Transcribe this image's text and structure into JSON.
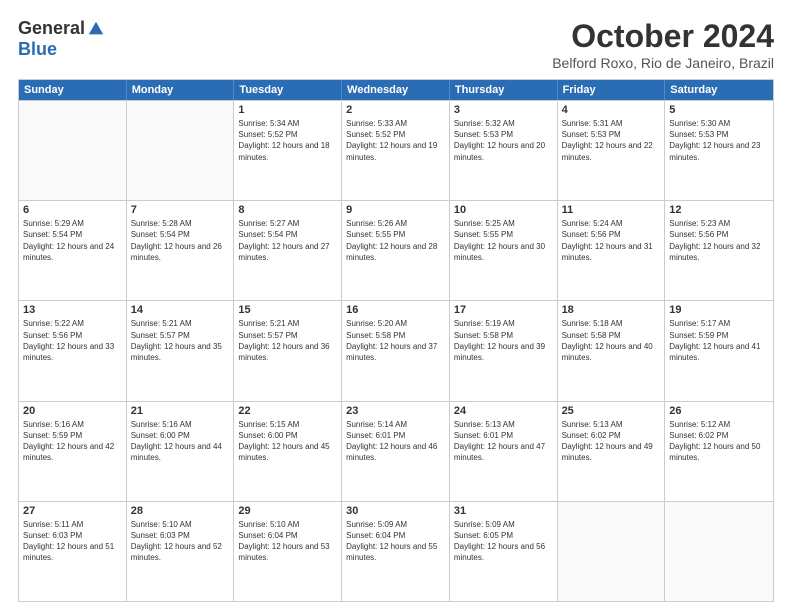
{
  "header": {
    "logo_general": "General",
    "logo_blue": "Blue",
    "month_title": "October 2024",
    "subtitle": "Belford Roxo, Rio de Janeiro, Brazil"
  },
  "weekdays": [
    "Sunday",
    "Monday",
    "Tuesday",
    "Wednesday",
    "Thursday",
    "Friday",
    "Saturday"
  ],
  "weeks": [
    [
      {
        "day": "",
        "sunrise": "",
        "sunset": "",
        "daylight": ""
      },
      {
        "day": "",
        "sunrise": "",
        "sunset": "",
        "daylight": ""
      },
      {
        "day": "1",
        "sunrise": "Sunrise: 5:34 AM",
        "sunset": "Sunset: 5:52 PM",
        "daylight": "Daylight: 12 hours and 18 minutes."
      },
      {
        "day": "2",
        "sunrise": "Sunrise: 5:33 AM",
        "sunset": "Sunset: 5:52 PM",
        "daylight": "Daylight: 12 hours and 19 minutes."
      },
      {
        "day": "3",
        "sunrise": "Sunrise: 5:32 AM",
        "sunset": "Sunset: 5:53 PM",
        "daylight": "Daylight: 12 hours and 20 minutes."
      },
      {
        "day": "4",
        "sunrise": "Sunrise: 5:31 AM",
        "sunset": "Sunset: 5:53 PM",
        "daylight": "Daylight: 12 hours and 22 minutes."
      },
      {
        "day": "5",
        "sunrise": "Sunrise: 5:30 AM",
        "sunset": "Sunset: 5:53 PM",
        "daylight": "Daylight: 12 hours and 23 minutes."
      }
    ],
    [
      {
        "day": "6",
        "sunrise": "Sunrise: 5:29 AM",
        "sunset": "Sunset: 5:54 PM",
        "daylight": "Daylight: 12 hours and 24 minutes."
      },
      {
        "day": "7",
        "sunrise": "Sunrise: 5:28 AM",
        "sunset": "Sunset: 5:54 PM",
        "daylight": "Daylight: 12 hours and 26 minutes."
      },
      {
        "day": "8",
        "sunrise": "Sunrise: 5:27 AM",
        "sunset": "Sunset: 5:54 PM",
        "daylight": "Daylight: 12 hours and 27 minutes."
      },
      {
        "day": "9",
        "sunrise": "Sunrise: 5:26 AM",
        "sunset": "Sunset: 5:55 PM",
        "daylight": "Daylight: 12 hours and 28 minutes."
      },
      {
        "day": "10",
        "sunrise": "Sunrise: 5:25 AM",
        "sunset": "Sunset: 5:55 PM",
        "daylight": "Daylight: 12 hours and 30 minutes."
      },
      {
        "day": "11",
        "sunrise": "Sunrise: 5:24 AM",
        "sunset": "Sunset: 5:56 PM",
        "daylight": "Daylight: 12 hours and 31 minutes."
      },
      {
        "day": "12",
        "sunrise": "Sunrise: 5:23 AM",
        "sunset": "Sunset: 5:56 PM",
        "daylight": "Daylight: 12 hours and 32 minutes."
      }
    ],
    [
      {
        "day": "13",
        "sunrise": "Sunrise: 5:22 AM",
        "sunset": "Sunset: 5:56 PM",
        "daylight": "Daylight: 12 hours and 33 minutes."
      },
      {
        "day": "14",
        "sunrise": "Sunrise: 5:21 AM",
        "sunset": "Sunset: 5:57 PM",
        "daylight": "Daylight: 12 hours and 35 minutes."
      },
      {
        "day": "15",
        "sunrise": "Sunrise: 5:21 AM",
        "sunset": "Sunset: 5:57 PM",
        "daylight": "Daylight: 12 hours and 36 minutes."
      },
      {
        "day": "16",
        "sunrise": "Sunrise: 5:20 AM",
        "sunset": "Sunset: 5:58 PM",
        "daylight": "Daylight: 12 hours and 37 minutes."
      },
      {
        "day": "17",
        "sunrise": "Sunrise: 5:19 AM",
        "sunset": "Sunset: 5:58 PM",
        "daylight": "Daylight: 12 hours and 39 minutes."
      },
      {
        "day": "18",
        "sunrise": "Sunrise: 5:18 AM",
        "sunset": "Sunset: 5:58 PM",
        "daylight": "Daylight: 12 hours and 40 minutes."
      },
      {
        "day": "19",
        "sunrise": "Sunrise: 5:17 AM",
        "sunset": "Sunset: 5:59 PM",
        "daylight": "Daylight: 12 hours and 41 minutes."
      }
    ],
    [
      {
        "day": "20",
        "sunrise": "Sunrise: 5:16 AM",
        "sunset": "Sunset: 5:59 PM",
        "daylight": "Daylight: 12 hours and 42 minutes."
      },
      {
        "day": "21",
        "sunrise": "Sunrise: 5:16 AM",
        "sunset": "Sunset: 6:00 PM",
        "daylight": "Daylight: 12 hours and 44 minutes."
      },
      {
        "day": "22",
        "sunrise": "Sunrise: 5:15 AM",
        "sunset": "Sunset: 6:00 PM",
        "daylight": "Daylight: 12 hours and 45 minutes."
      },
      {
        "day": "23",
        "sunrise": "Sunrise: 5:14 AM",
        "sunset": "Sunset: 6:01 PM",
        "daylight": "Daylight: 12 hours and 46 minutes."
      },
      {
        "day": "24",
        "sunrise": "Sunrise: 5:13 AM",
        "sunset": "Sunset: 6:01 PM",
        "daylight": "Daylight: 12 hours and 47 minutes."
      },
      {
        "day": "25",
        "sunrise": "Sunrise: 5:13 AM",
        "sunset": "Sunset: 6:02 PM",
        "daylight": "Daylight: 12 hours and 49 minutes."
      },
      {
        "day": "26",
        "sunrise": "Sunrise: 5:12 AM",
        "sunset": "Sunset: 6:02 PM",
        "daylight": "Daylight: 12 hours and 50 minutes."
      }
    ],
    [
      {
        "day": "27",
        "sunrise": "Sunrise: 5:11 AM",
        "sunset": "Sunset: 6:03 PM",
        "daylight": "Daylight: 12 hours and 51 minutes."
      },
      {
        "day": "28",
        "sunrise": "Sunrise: 5:10 AM",
        "sunset": "Sunset: 6:03 PM",
        "daylight": "Daylight: 12 hours and 52 minutes."
      },
      {
        "day": "29",
        "sunrise": "Sunrise: 5:10 AM",
        "sunset": "Sunset: 6:04 PM",
        "daylight": "Daylight: 12 hours and 53 minutes."
      },
      {
        "day": "30",
        "sunrise": "Sunrise: 5:09 AM",
        "sunset": "Sunset: 6:04 PM",
        "daylight": "Daylight: 12 hours and 55 minutes."
      },
      {
        "day": "31",
        "sunrise": "Sunrise: 5:09 AM",
        "sunset": "Sunset: 6:05 PM",
        "daylight": "Daylight: 12 hours and 56 minutes."
      },
      {
        "day": "",
        "sunrise": "",
        "sunset": "",
        "daylight": ""
      },
      {
        "day": "",
        "sunrise": "",
        "sunset": "",
        "daylight": ""
      }
    ]
  ]
}
